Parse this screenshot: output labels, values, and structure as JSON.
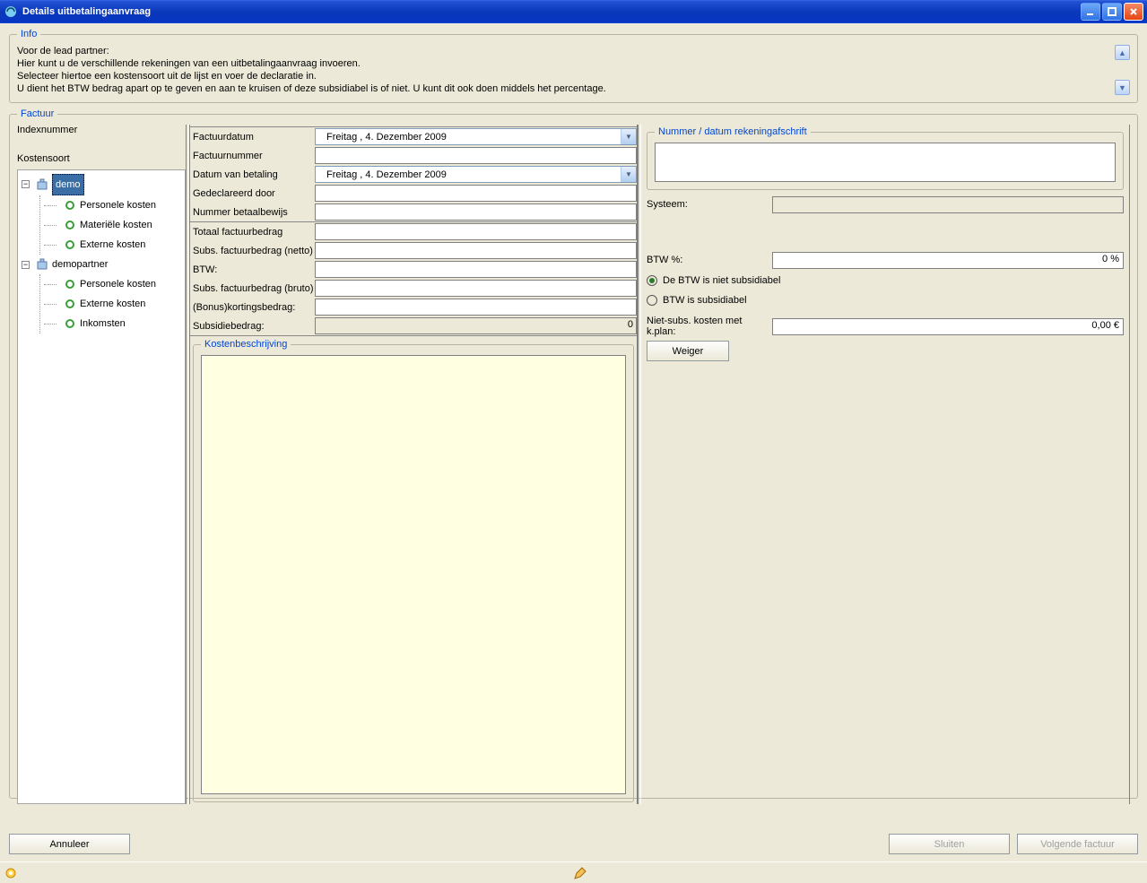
{
  "window": {
    "title": "Details uitbetalingaanvraag"
  },
  "info": {
    "legend": "Info",
    "line1": "Voor de lead partner:",
    "line2": "Hier kunt u de verschillende rekeningen van een uitbetalingaanvraag invoeren.",
    "line3": "Selecteer hiertoe een kostensoort uit de lijst en voer de declaratie in.",
    "line4": "U dient het BTW bedrag apart op te geven en aan te kruisen of deze subsidiabel is of niet. U kunt dit ook doen middels het percentage."
  },
  "factuur": {
    "legend": "Factuur",
    "indexnummer_label": "Indexnummer",
    "kostensoort_label": "Kostensoort",
    "tree": {
      "partner1": {
        "name": "demo",
        "children": [
          "Personele kosten",
          "Materiële kosten",
          "Externe kosten"
        ]
      },
      "partner2": {
        "name": "demopartner",
        "children": [
          "Personele kosten",
          "Externe kosten",
          "Inkomsten"
        ]
      }
    },
    "form": {
      "factuurdatum_label": "Factuurdatum",
      "factuurdatum_value": "Freitag   ,  4. Dezember 2009",
      "factuurnummer_label": "Factuurnummer",
      "datum_betaling_label": "Datum van betaling",
      "datum_betaling_value": "Freitag   ,  4. Dezember 2009",
      "gedeclareerd_label": "Gedeclareerd door",
      "nummer_betaal_label": "Nummer betaalbewijs",
      "totaal_label": "Totaal factuurbedrag",
      "subs_netto_label": "Subs. factuurbedrag (netto)",
      "btw_label": "BTW:",
      "subs_bruto_label": "Subs. factuurbedrag (bruto)",
      "bonus_label": "(Bonus)kortingsbedrag:",
      "subsidie_label": "Subsidiebedrag:",
      "subsidie_value": "0"
    },
    "kosten_legend": "Kostenbeschrijving"
  },
  "right": {
    "nummer_legend": "Nummer / datum rekeningafschrift",
    "systeem_label": "Systeem:",
    "btw_pct_label": "BTW %:",
    "btw_pct_value": "0 %",
    "radio1": "De BTW is niet subsidiabel",
    "radio2": "BTW is subsidiabel",
    "niet_subs_label": "Niet-subs. kosten met k.plan:",
    "niet_subs_value": "0,00 €",
    "weiger_label": "Weiger"
  },
  "buttons": {
    "annuleer": "Annuleer",
    "sluiten": "Sluiten",
    "volgende": "Volgende factuur"
  }
}
